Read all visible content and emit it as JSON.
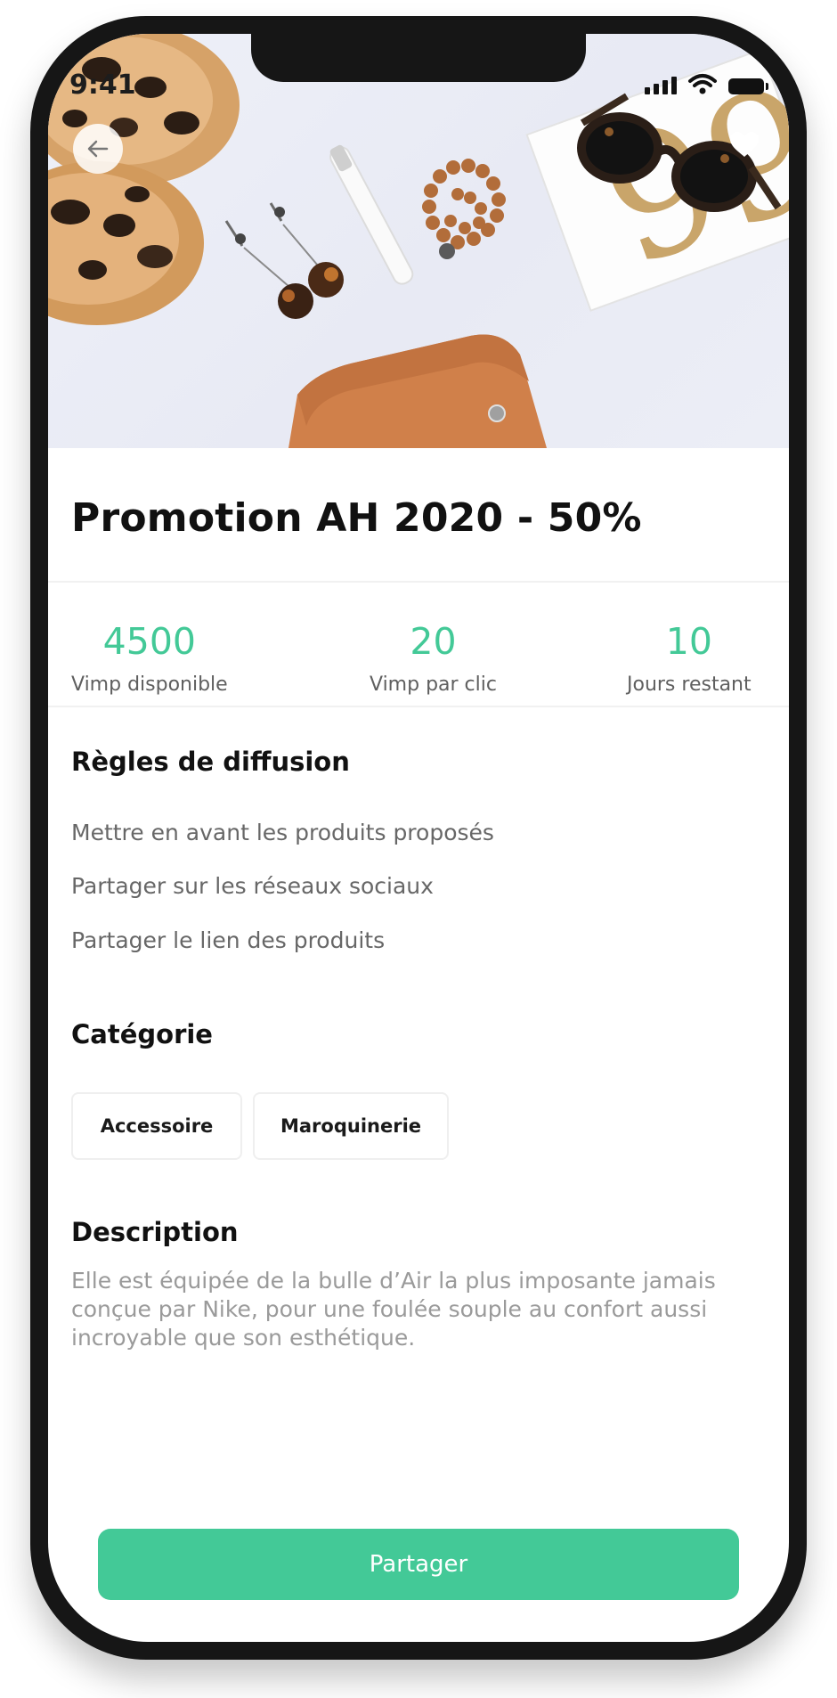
{
  "status_bar": {
    "time": "9:41"
  },
  "hero": {
    "back_icon": "arrow-left-icon",
    "favorite_icon": "heart-icon"
  },
  "promotion": {
    "title": "Promotion AH 2020 - 50%",
    "stats": [
      {
        "value": "4500",
        "label": "Vimp disponible"
      },
      {
        "value": "20",
        "label": "Vimp par clic"
      },
      {
        "value": "10",
        "label": "Jours restant"
      }
    ]
  },
  "rules": {
    "title": "Règles de diffusion",
    "items": [
      "Mettre en avant les produits proposés",
      "Partager sur les réseaux sociaux",
      "Partager le lien des produits"
    ]
  },
  "category": {
    "title": "Catégorie",
    "chips": [
      "Accessoire",
      "Maroquinerie"
    ]
  },
  "description": {
    "title": "Description",
    "text": "Elle est équipée de la bulle d’Air la plus imposante jamais conçue par Nike, pour une foulée souple au confort aussi incroyable que son esthétique."
  },
  "actions": {
    "share_label": "Partager"
  },
  "colors": {
    "accent": "#43c997",
    "title_text": "#111111",
    "muted_text": "#676767"
  }
}
